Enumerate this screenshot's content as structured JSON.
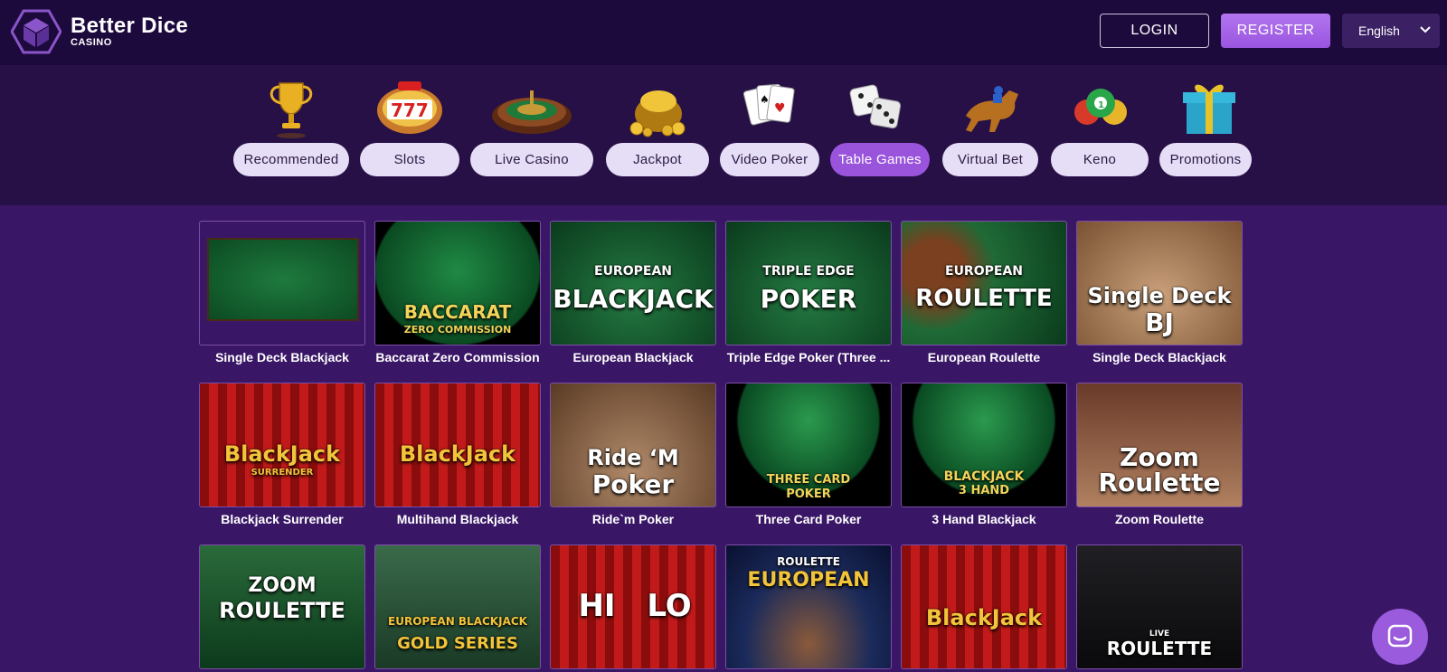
{
  "brand": {
    "name": "Better Dice",
    "sub": "CASINO"
  },
  "header": {
    "login_label": "LOGIN",
    "register_label": "REGISTER",
    "language": "English"
  },
  "categories": [
    {
      "label": "Recommended",
      "icon": "trophy-icon"
    },
    {
      "label": "Slots",
      "icon": "slot-machine-icon"
    },
    {
      "label": "Live Casino",
      "icon": "roulette-wheel-icon"
    },
    {
      "label": "Jackpot",
      "icon": "gold-coins-icon"
    },
    {
      "label": "Video Poker",
      "icon": "playing-cards-icon"
    },
    {
      "label": "Table Games",
      "icon": "dice-icon",
      "active": true
    },
    {
      "label": "Virtual Bet",
      "icon": "racehorse-icon"
    },
    {
      "label": "Keno",
      "icon": "lottery-balls-icon"
    },
    {
      "label": "Promotions",
      "icon": "gift-box-icon"
    }
  ],
  "games": [
    {
      "label": "Single Deck Blackjack",
      "thumb_text": "",
      "thumb_sub": ""
    },
    {
      "label": "Baccarat Zero Commission",
      "thumb_text": "BACCARAT",
      "thumb_sub": "ZERO COMMISSION"
    },
    {
      "label": "European Blackjack",
      "thumb_text": "BLACKJACK",
      "thumb_sub": "EUROPEAN"
    },
    {
      "label": "Triple Edge Poker (Three ...",
      "thumb_text": "POKER",
      "thumb_sub": "TRIPLE EDGE"
    },
    {
      "label": "European Roulette",
      "thumb_text": "ROULETTE",
      "thumb_sub": "EUROPEAN"
    },
    {
      "label": "Single Deck Blackjack",
      "thumb_text": "Single Deck",
      "thumb_sub": "BJ"
    },
    {
      "label": "Blackjack Surrender",
      "thumb_text": "BlackJack",
      "thumb_sub": "SURRENDER"
    },
    {
      "label": "Multihand Blackjack",
      "thumb_text": "BlackJack",
      "thumb_sub": ""
    },
    {
      "label": "Ride`m Poker",
      "thumb_text": "Ride ‘M",
      "thumb_sub": "Poker"
    },
    {
      "label": "Three Card Poker",
      "thumb_text": "THREE CARD",
      "thumb_sub": "POKER"
    },
    {
      "label": "3 Hand Blackjack",
      "thumb_text": "BLACKJACK",
      "thumb_sub": "3 HAND"
    },
    {
      "label": "Zoom Roulette",
      "thumb_text": "Zoom",
      "thumb_sub": "Roulette"
    },
    {
      "label": "",
      "thumb_text": "ZOOM",
      "thumb_sub": "ROULETTE"
    },
    {
      "label": "",
      "thumb_text": "EUROPEAN BLACKJACK",
      "thumb_sub": "GOLD SERIES"
    },
    {
      "label": "",
      "thumb_text": "HI",
      "thumb_sub": "LO"
    },
    {
      "label": "",
      "thumb_text": "EUROPEAN",
      "thumb_sub": "ROULETTE"
    },
    {
      "label": "",
      "thumb_text": "BlackJack",
      "thumb_sub": ""
    },
    {
      "label": "",
      "thumb_text": "ROULETTE",
      "thumb_sub": "LIVE"
    }
  ],
  "colors": {
    "header_bg": "#1d0a3d",
    "catbar_bg": "#271046",
    "page_bg": "#3a1766",
    "accent": "#9a54dc"
  }
}
